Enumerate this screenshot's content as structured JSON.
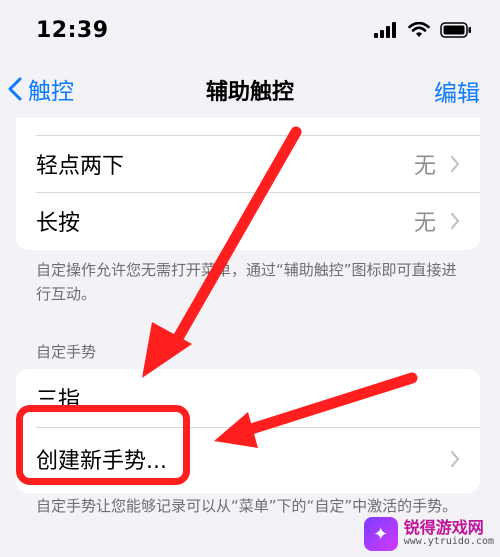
{
  "status_bar": {
    "time": "12:39"
  },
  "nav": {
    "back_label": "触控",
    "title": "辅助触控",
    "edit_label": "编辑"
  },
  "actions": [
    {
      "label": "轻点两下",
      "value": "无"
    },
    {
      "label": "长按",
      "value": "无"
    }
  ],
  "actions_footnote": "自定操作允许您无需打开菜单，通过“辅助触控”图标即可直接进行互动。",
  "gestures": {
    "header": "自定手势",
    "items": [
      {
        "label": "三指"
      },
      {
        "label": "创建新手势..."
      }
    ],
    "footnote": "自定手势让您能够记录可以从“菜单”下的“自定”中激活的手势。"
  },
  "watermark": {
    "name": "锐得游戏网",
    "url": "www.ytruido.com"
  },
  "colors": {
    "accent": "#0a7aff",
    "annotation": "#ff1f1f",
    "background": "#f2f2f7"
  }
}
